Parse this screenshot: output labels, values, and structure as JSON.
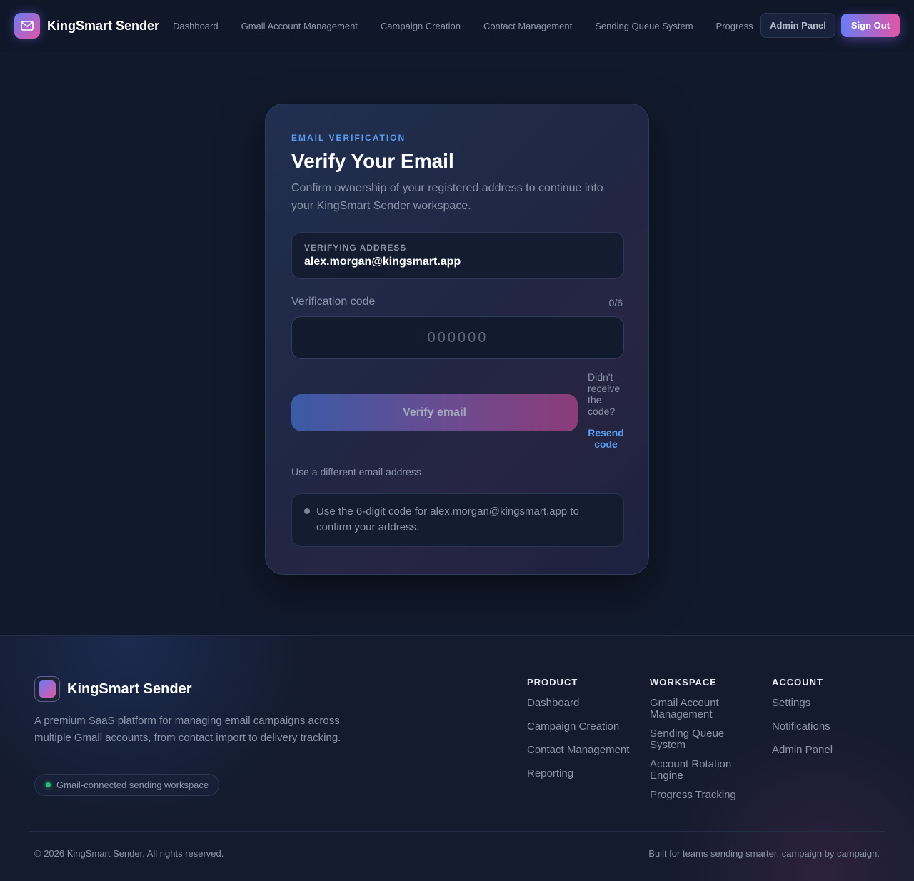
{
  "nav": {
    "brand": "KingSmart Sender",
    "links": [
      "Dashboard",
      "Gmail Account Management",
      "Campaign Creation",
      "Contact Management",
      "Sending Queue System",
      "Progress"
    ],
    "admin_label": "Admin Panel",
    "signout_label": "Sign Out"
  },
  "verify": {
    "eyebrow": "EMAIL VERIFICATION",
    "title": "Verify Your Email",
    "subtitle": "Confirm ownership of your registered address to continue into your KingSmart Sender workspace.",
    "address_label": "VERIFYING ADDRESS",
    "address": "alex.morgan@kingsmart.app",
    "code_label": "Verification code",
    "code_count": "0/6",
    "code_value": "",
    "code_placeholder": "000000",
    "verify_label": "Verify email",
    "resend_question": "Didn't receive the code?",
    "resend_label": "Resend code",
    "different_email": "Use a different email address",
    "info": "Use the 6-digit code for alex.morgan@kingsmart.app to confirm your address."
  },
  "footer": {
    "brand": "KingSmart Sender",
    "description": "A premium SaaS platform for managing email campaigns across multiple Gmail accounts, from contact import to delivery tracking.",
    "badge": "Gmail-connected sending workspace",
    "columns": [
      {
        "title": "PRODUCT",
        "links": [
          "Dashboard",
          "Campaign Creation",
          "Contact Management",
          "Reporting"
        ]
      },
      {
        "title": "WORKSPACE",
        "links": [
          "Gmail Account Management",
          "Sending Queue System",
          "Account Rotation Engine",
          "Progress Tracking"
        ]
      },
      {
        "title": "ACCOUNT",
        "links": [
          "Settings",
          "Notifications",
          "Admin Panel"
        ]
      }
    ],
    "copyright": "© 2026 KingSmart Sender. All rights reserved.",
    "tagline": "Built for teams sending smarter, campaign by campaign."
  },
  "colors": {
    "accent_blue": "#5b9ef0",
    "gradient_start": "#6a7cf5",
    "gradient_end": "#e056a6",
    "status_green": "#21c07a"
  },
  "icons": {
    "brand_logo": "mail-icon"
  }
}
